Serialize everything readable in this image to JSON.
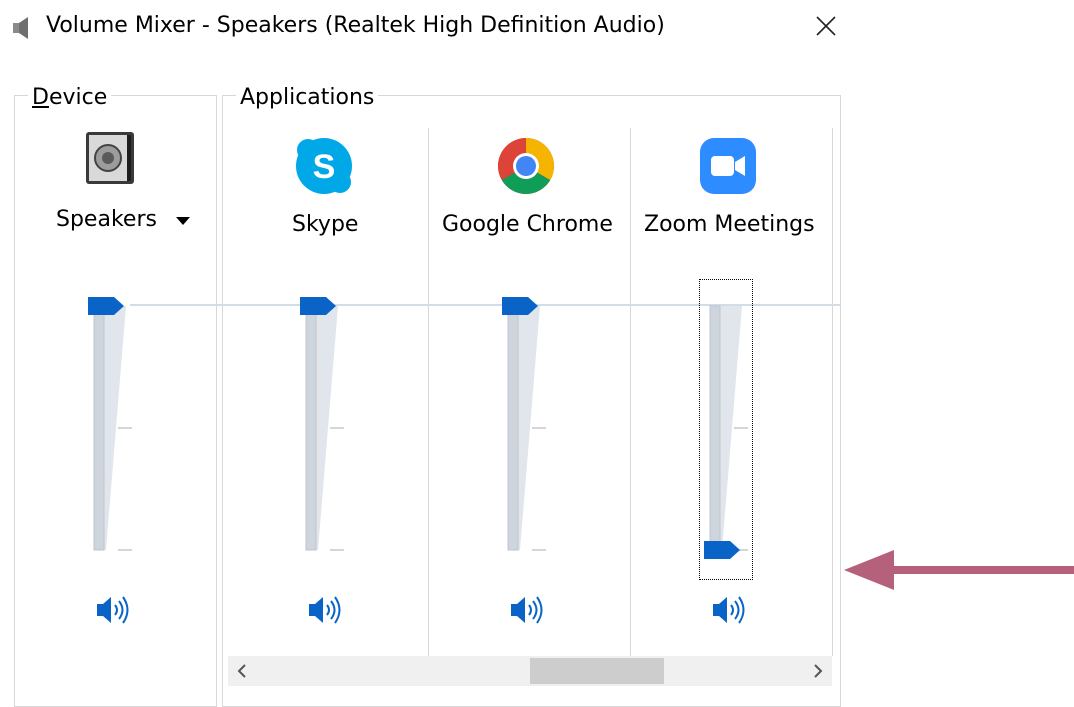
{
  "window": {
    "title": "Volume Mixer - Speakers (Realtek High Definition Audio)",
    "title_icon": "speaker-icon",
    "close_icon": "close-icon"
  },
  "device_group": {
    "legend_mnemonic": "D",
    "legend_rest": "evice",
    "device_name": "Speakers",
    "device_icon": "speaker-device-icon",
    "volume": 1.0
  },
  "applications_group": {
    "legend": "Applications",
    "apps": [
      {
        "name": "Skype",
        "icon": "skype-icon",
        "volume": 1.0
      },
      {
        "name": "Google Chrome",
        "icon": "chrome-icon",
        "volume": 1.0
      },
      {
        "name": "Zoom Meetings",
        "icon": "zoom-icon",
        "volume": 0.0
      }
    ]
  },
  "colors": {
    "accent": "#0a64c8",
    "annotation_arrow": "#b5617c"
  }
}
